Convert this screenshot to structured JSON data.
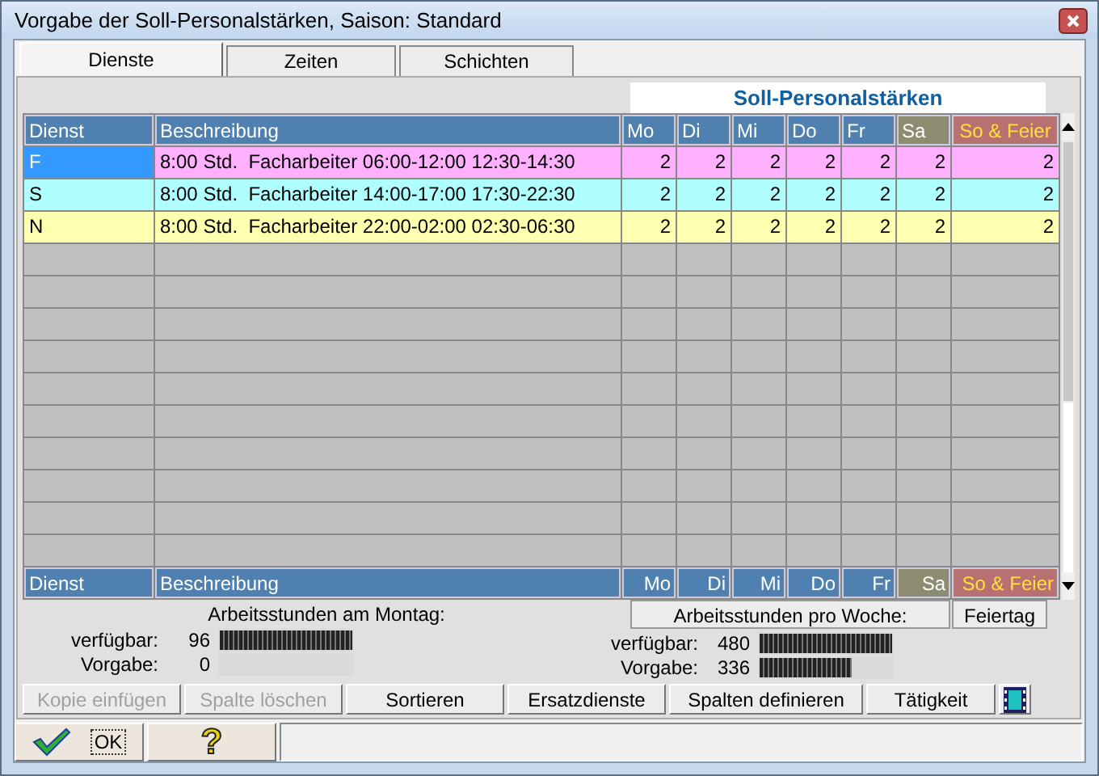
{
  "window": {
    "title": "Vorgabe der Soll-Personalstärken, Saison: Standard"
  },
  "tabs": [
    {
      "label": "Dienste",
      "selected": true
    },
    {
      "label": "Zeiten",
      "selected": false
    },
    {
      "label": "Schichten",
      "selected": false
    }
  ],
  "table": {
    "group_title": "Soll-Personalstärken",
    "columns": [
      {
        "label": "Dienst",
        "kind": "key",
        "color": "#5080b0"
      },
      {
        "label": "Beschreibung",
        "kind": "text",
        "color": "#5080b0"
      },
      {
        "label": "Mo",
        "kind": "day",
        "color": "#5080b0"
      },
      {
        "label": "Di",
        "kind": "day",
        "color": "#5080b0"
      },
      {
        "label": "Mi",
        "kind": "day",
        "color": "#5080b0"
      },
      {
        "label": "Do",
        "kind": "day",
        "color": "#5080b0"
      },
      {
        "label": "Fr",
        "kind": "day",
        "color": "#5080b0"
      },
      {
        "label": "Sa",
        "kind": "day",
        "color": "#8c8c70"
      },
      {
        "label": "So & Feier",
        "kind": "holiday",
        "color": "#b87070"
      }
    ],
    "rows": [
      {
        "color": "#ffb0ff",
        "selected": true,
        "cells": [
          "F",
          "8:00 Std.  Facharbeiter 06:00-12:00 12:30-14:30",
          "2",
          "2",
          "2",
          "2",
          "2",
          "2",
          "2"
        ]
      },
      {
        "color": "#b0ffff",
        "selected": false,
        "cells": [
          "S",
          "8:00 Std.  Facharbeiter 14:00-17:00 17:30-22:30",
          "2",
          "2",
          "2",
          "2",
          "2",
          "2",
          "2"
        ]
      },
      {
        "color": "#ffffb0",
        "selected": false,
        "cells": [
          "N",
          "8:00 Std.  Facharbeiter 22:00-02:00 02:30-06:30",
          "2",
          "2",
          "2",
          "2",
          "2",
          "2",
          "2"
        ]
      }
    ],
    "footer": [
      "Dienst",
      "Beschreibung",
      "Mo",
      "Di",
      "Mi",
      "Do",
      "Fr",
      "Sa",
      "So & Feier"
    ]
  },
  "summary": {
    "day_title": "Arbeitsstunden am Montag:",
    "day_stats": [
      {
        "label": "verfügbar:",
        "value": "96",
        "level": 1
      },
      {
        "label": "Vorgabe:",
        "value": "0",
        "level": 0
      }
    ],
    "week_title": "Arbeitsstunden pro Woche:",
    "holiday_title": "Feiertag",
    "week_stats": [
      {
        "label": "verfügbar:",
        "value": "480",
        "level": 1
      },
      {
        "label": "Vorgabe:",
        "value": "336",
        "level": 0.7
      }
    ]
  },
  "buttons": [
    {
      "kind": "text",
      "label": "Kopie einfügen",
      "disabled": true
    },
    {
      "kind": "text",
      "label": "Spalte löschen",
      "disabled": true
    },
    {
      "kind": "text",
      "label": "Sortieren",
      "disabled": false
    },
    {
      "kind": "text",
      "label": "Ersatzdienste",
      "disabled": false
    },
    {
      "kind": "text",
      "label": "Spalten definieren",
      "disabled": false
    },
    {
      "kind": "text",
      "label": "Tätigkeit",
      "disabled": false
    },
    {
      "kind": "icon",
      "disabled": false
    }
  ],
  "ok_button": {
    "label": "OK"
  },
  "help_button": {
    "label": "?"
  }
}
